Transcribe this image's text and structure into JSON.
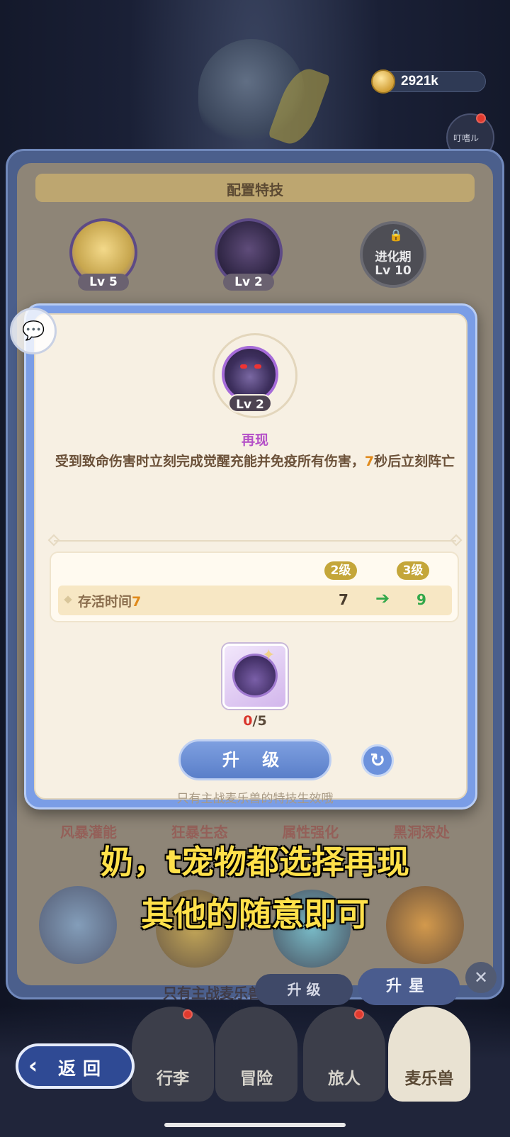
{
  "hud": {
    "coins": "2921k",
    "side_button_label": "叮嗜ル"
  },
  "outer_panel": {
    "title": "配置特技",
    "slots": [
      {
        "level": "Lv 5"
      },
      {
        "level": "Lv 2"
      },
      {
        "lock_title": "进化期",
        "lock_level": "Lv 10"
      }
    ],
    "skill_tabs": [
      "风暴灌能",
      "狂暴生态",
      "属性强化",
      "黑洞深处"
    ],
    "hint": "只有主战麦乐兽的特技生效哦",
    "upgrade_label": "升 级",
    "star_label": "升星"
  },
  "modal": {
    "skill_level": "Lv 2",
    "skill_name": "再现",
    "desc_part1": "受到致命伤害时立刻完成觉醒充能并免疫所有伤害，",
    "desc_highlight": "7",
    "desc_part2": "秒后立刻阵亡",
    "level_from": "2级",
    "level_to": "3级",
    "stat_label": "存活时间",
    "stat_label_value": "7",
    "stat_old": "7",
    "stat_new": "9",
    "item_have": "0",
    "item_need": "/5",
    "upgrade_label": "升 级",
    "hint": "只有主战麦乐兽的特技生效哦"
  },
  "subtitle": {
    "line1": "奶，t宠物都选择再现",
    "line2": "其他的随意即可"
  },
  "nav": {
    "back_label": "返回",
    "items": [
      "行李",
      "冒险",
      "旅人",
      "麦乐兽"
    ]
  },
  "colors": {
    "accent_blue": "#7a9de6",
    "panel_cream": "#f7f0e3",
    "skill_name_purple": "#b550c8",
    "highlight_orange": "#e08a1c",
    "increase_green": "#33a84a",
    "subtitle_yellow": "#ffe14a"
  },
  "icons": {
    "coin": "coin-icon",
    "chat": "chat-bubble-icon",
    "lock": "lock-icon",
    "arrow": "arrow-right-icon",
    "refresh": "refresh-icon",
    "back": "chevron-left-icon"
  }
}
